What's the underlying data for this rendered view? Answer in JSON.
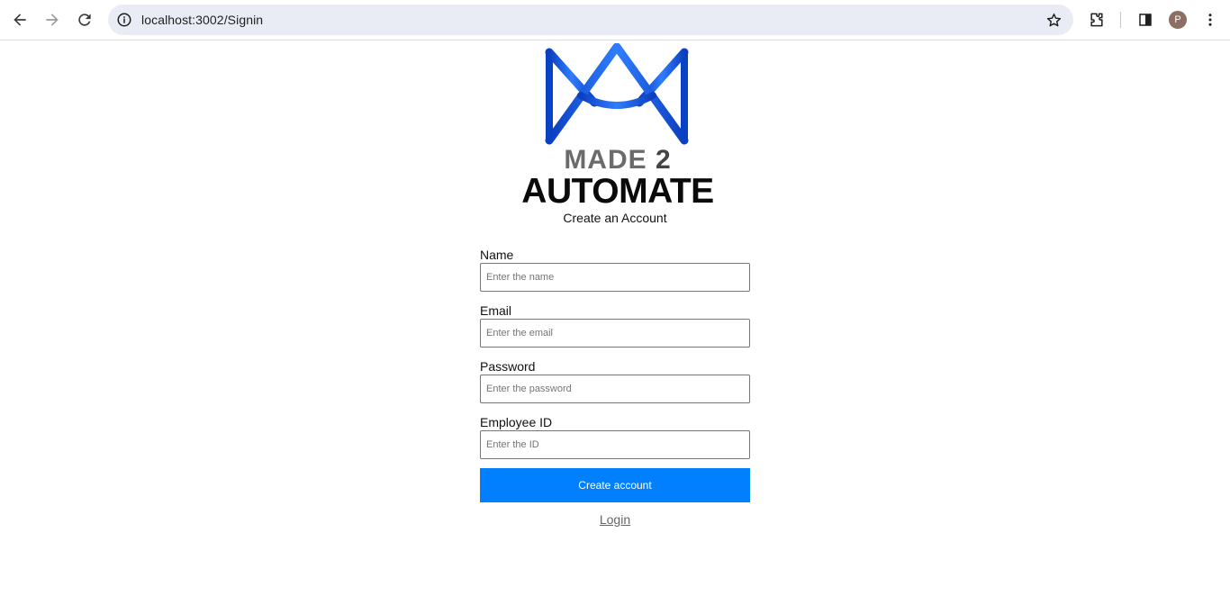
{
  "browser": {
    "url": "localhost:3002/Signin",
    "profile_initial": "P",
    "icons": [
      "back-arrow-icon",
      "forward-arrow-icon",
      "reload-icon",
      "site-info-icon",
      "bookmark-star-icon",
      "extensions-icon",
      "side-panel-icon",
      "kebab-menu-icon"
    ]
  },
  "logo": {
    "line1": "MADE",
    "line1_number": "2",
    "line2": "AUTOMATE",
    "brand_color": "#0055d4"
  },
  "page": {
    "subtitle": "Create an Account"
  },
  "form": {
    "fields": [
      {
        "label": "Name",
        "placeholder": "Enter the name",
        "value": ""
      },
      {
        "label": "Email",
        "placeholder": "Enter the email",
        "value": ""
      },
      {
        "label": "Password",
        "placeholder": "Enter the password",
        "value": ""
      },
      {
        "label": "Employee ID",
        "placeholder": "Enter the ID",
        "value": ""
      }
    ],
    "submit_label": "Create account",
    "submit_color": "#0080ff",
    "login_link": "Login"
  }
}
